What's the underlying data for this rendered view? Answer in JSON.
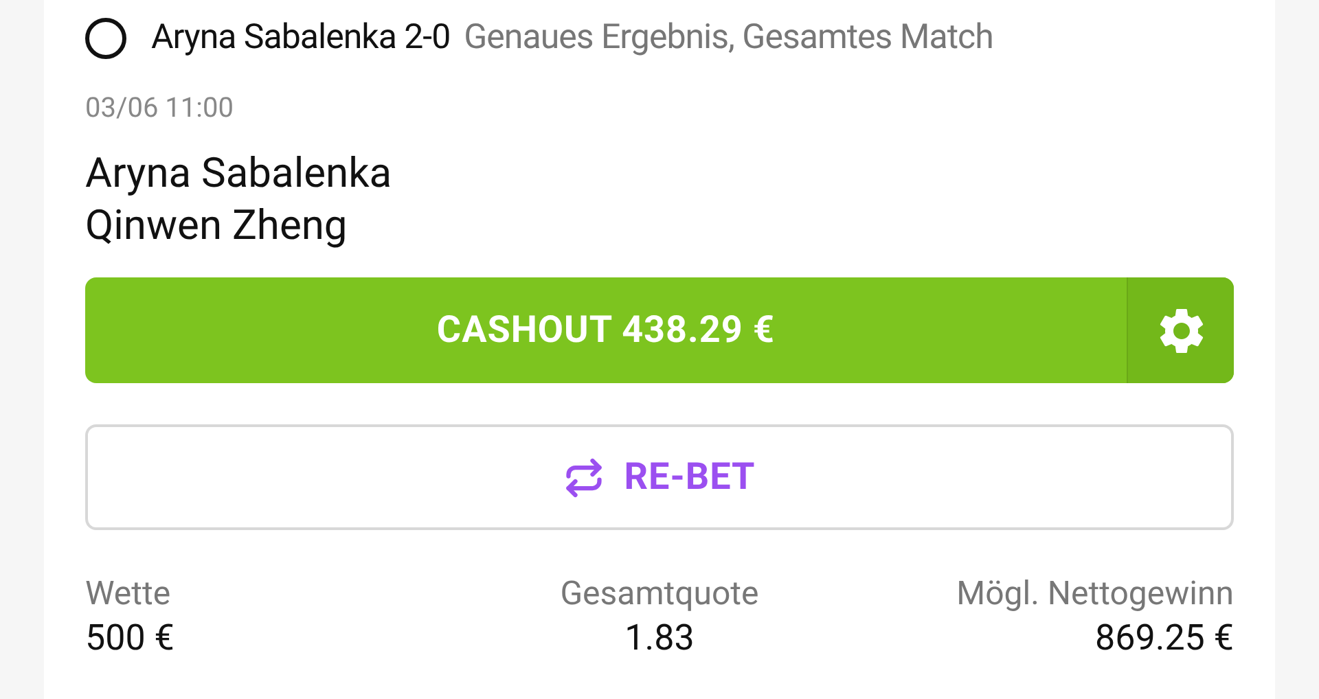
{
  "selection": {
    "selected": false,
    "pick": "Aryna Sabalenka 2-0",
    "market": "Genaues Ergebnis, Gesamtes Match"
  },
  "event": {
    "datetime": "03/06 11:00",
    "participants": [
      "Aryna Sabalenka",
      "Qinwen Zheng"
    ]
  },
  "cashout_button": {
    "label": "CASHOUT 438.29 €"
  },
  "rebet_button": {
    "label": "RE-BET"
  },
  "summary": [
    {
      "label": "Wette",
      "value": "500 €"
    },
    {
      "label": "Gesamtquote",
      "value": "1.83"
    },
    {
      "label": "Mögl. Nettogewinn",
      "value": "869.25 €"
    }
  ]
}
